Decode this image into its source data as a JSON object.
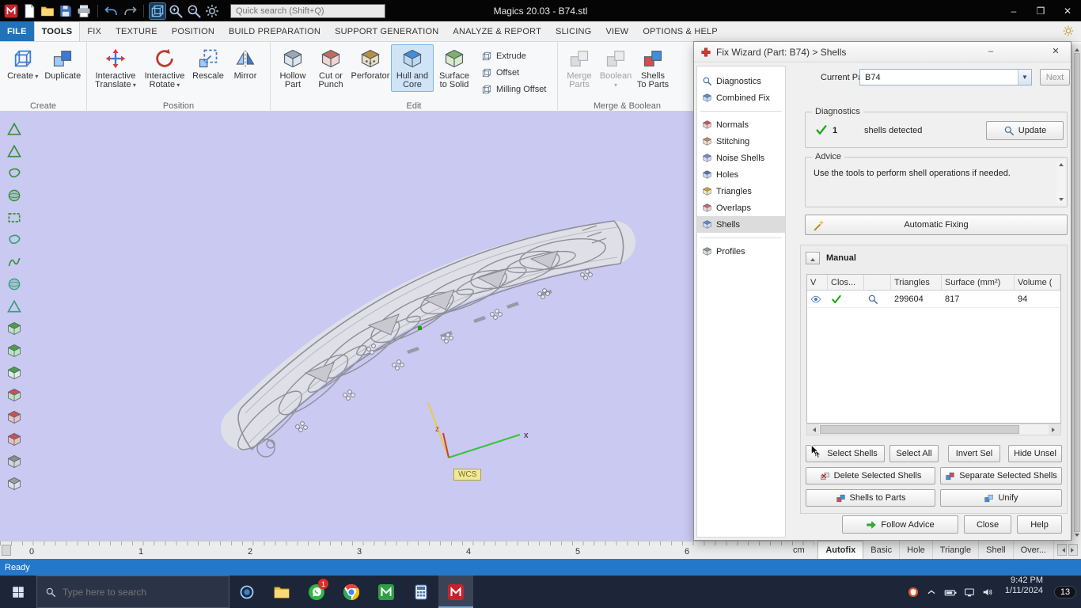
{
  "colors": {
    "accent": "#2272b9",
    "viewport": "#c9c9f2",
    "statusbar": "#2577c8",
    "taskbar": "#1d2638",
    "active_highlight": "#cfe4f7",
    "check_green": "#1ca81c",
    "magics_red": "#c6222c"
  },
  "titlebar": {
    "title": "Magics 20.03 - B74.stl",
    "search_placeholder": "Quick search (Shift+Q)",
    "icons": [
      "app-logo",
      "new-document",
      "open",
      "save",
      "print",
      "undo",
      "redo",
      "view-cube",
      "zoom-in",
      "zoom-out",
      "settings"
    ],
    "window_controls": [
      "minimize",
      "restore",
      "close"
    ]
  },
  "menu_tabs": {
    "active": "TOOLS",
    "items": [
      "FILE",
      "TOOLS",
      "FIX",
      "TEXTURE",
      "POSITION",
      "BUILD PREPARATION",
      "SUPPORT GENERATION",
      "ANALYZE & REPORT",
      "SLICING",
      "VIEW",
      "OPTIONS & HELP"
    ]
  },
  "ribbon": {
    "active_button": "Hull and Core",
    "disabled_buttons": [
      "Merge Parts",
      "Boolean"
    ],
    "groups": [
      {
        "label": "Create",
        "buttons": [
          "Create",
          "Duplicate"
        ]
      },
      {
        "label": "Position",
        "buttons": [
          "Interactive Translate",
          "Interactive Rotate",
          "Rescale",
          "Mirror"
        ]
      },
      {
        "label": "Edit",
        "buttons": [
          "Hollow Part",
          "Cut or Punch",
          "Perforator",
          "Hull and Core",
          "Surface to Solid"
        ],
        "small_buttons": [
          "Extrude",
          "Offset",
          "Milling Offset"
        ]
      },
      {
        "label": "Merge & Boolean",
        "buttons": [
          "Merge Parts",
          "Boolean",
          "Shells To Parts"
        ]
      }
    ]
  },
  "left_toolbar_icons": [
    "marking-triangle-tool",
    "marking-plane-tool",
    "marking-surface-tool",
    "marking-shell-tool",
    "rectangle-selection-tool",
    "ellipse-selection-tool",
    "freeform-selection-tool",
    "brush-selection-tool",
    "polygon-selection-tool",
    "view-iso-cube",
    "view-top-cube",
    "view-front-cube",
    "view-right-cube",
    "view-back-cube",
    "view-left-cube",
    "view-bottom-cube",
    "view-unzoom-cube"
  ],
  "viewport": {
    "wcs_label": "WCS",
    "axis_labels": {
      "x": "x",
      "z": "z"
    }
  },
  "ruler": {
    "unit": "cm",
    "ticks": [
      "0",
      "1",
      "2",
      "3",
      "4",
      "5",
      "6"
    ]
  },
  "page_tabs": {
    "active": "Autofix",
    "items": [
      "Autofix",
      "Basic",
      "Hole",
      "Triangle",
      "Shell",
      "Over..."
    ]
  },
  "statusbar": {
    "text": "Ready"
  },
  "fix_wizard": {
    "title": "Fix Wizard (Part: B74) > Shells",
    "nav": {
      "active": "Shells",
      "sections": [
        [
          "Diagnostics",
          "Combined Fix"
        ],
        [
          "Normals",
          "Stitching",
          "Noise Shells",
          "Holes",
          "Triangles",
          "Overlaps",
          "Shells"
        ],
        [
          "Profiles"
        ]
      ]
    },
    "current_part_label": "Current Part:",
    "current_part_value": "B74",
    "next_label": "Next",
    "diagnostics": {
      "legend": "Diagnostics",
      "count": "1",
      "text": "shells detected",
      "update_label": "Update"
    },
    "advice": {
      "legend": "Advice",
      "text": "Use the tools to perform shell operations if needed."
    },
    "automatic_fixing_label": "Automatic Fixing",
    "manual": {
      "label": "Manual",
      "table": {
        "headers": [
          "V",
          "Clos...",
          "",
          "Triangles",
          "Surface (mm²)",
          "Volume ("
        ],
        "rows": [
          [
            "visible",
            "closed",
            "zoom",
            "299604",
            "817",
            "94"
          ]
        ]
      },
      "buttons": [
        [
          "Select Shells",
          "Select All",
          "Invert Sel",
          "Hide Unsel"
        ],
        [
          "Delete Selected Shells",
          "Separate Selected Shells"
        ],
        [
          "Shells to Parts",
          "Unify"
        ]
      ]
    },
    "footer_buttons": [
      "Follow Advice",
      "Close",
      "Help"
    ]
  },
  "taskbar": {
    "search_placeholder": "Type here to search",
    "app_icons": [
      "start",
      "cortana",
      "file-explorer",
      "whatsapp",
      "chrome",
      "green-m-app",
      "calculator",
      "magics"
    ],
    "whatsapp_badge": "1",
    "tray_icons": [
      "antivirus",
      "hidden-icons",
      "battery",
      "network",
      "volume"
    ],
    "time": "9:42 PM",
    "date": "1/11/2024",
    "notification_badge": "13"
  }
}
